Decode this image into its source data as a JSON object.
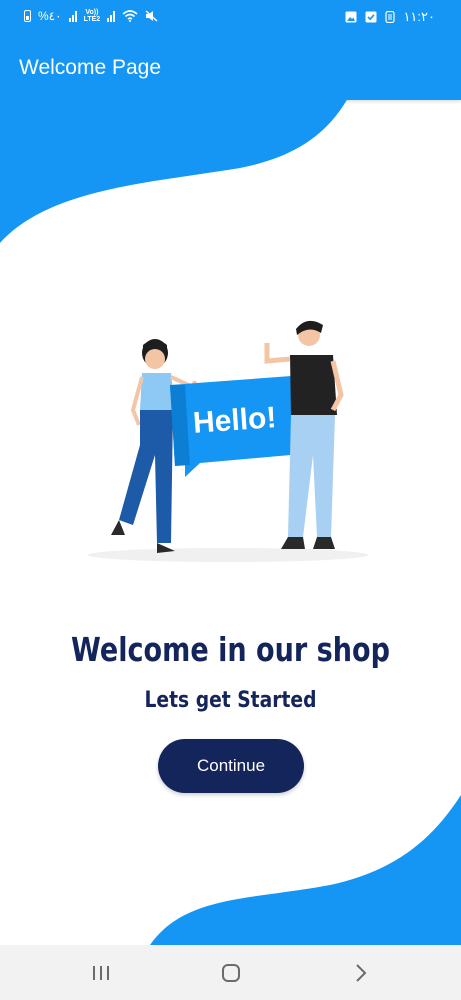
{
  "status_bar": {
    "battery_percent": "%٤٠",
    "volte_label": "Vo))\nLTE2",
    "time": "١١:٢٠"
  },
  "app_bar": {
    "title": "Welcome Page"
  },
  "illustration": {
    "speech_bubble_text": "Hello!"
  },
  "main": {
    "headline": "Welcome in our shop",
    "subline": "Lets get Started",
    "continue_label": "Continue"
  },
  "colors": {
    "primary_blue": "#1596f4",
    "navy": "#14255b"
  },
  "icons": {
    "nav_recents": "recents-icon",
    "nav_home": "home-icon",
    "nav_back": "back-icon"
  }
}
